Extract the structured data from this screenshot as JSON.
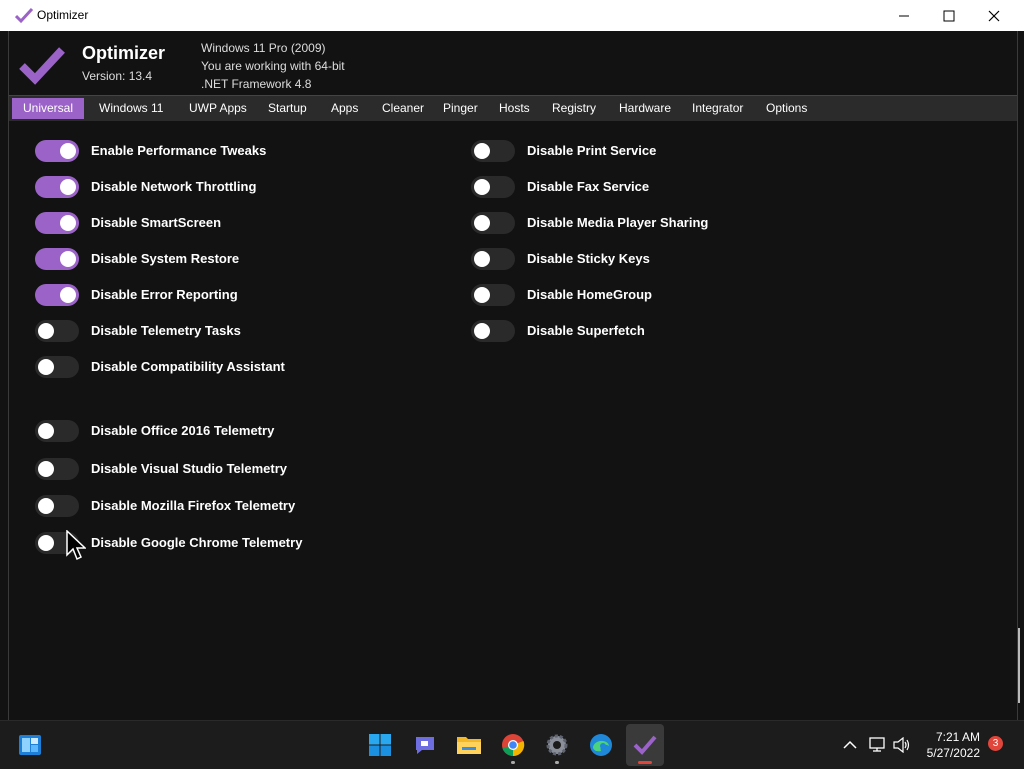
{
  "window": {
    "title": "Optimizer"
  },
  "app": {
    "name": "Optimizer",
    "version": "Version: 13.4",
    "sysinfo": [
      "Windows 11 Pro (2009)",
      "You are working with 64-bit",
      ".NET Framework 4.8"
    ],
    "accent": "#9b63c8"
  },
  "tabs": [
    {
      "label": "Universal",
      "active": true
    },
    {
      "label": "Windows 11",
      "active": false
    },
    {
      "label": "UWP Apps",
      "active": false
    },
    {
      "label": "Startup",
      "active": false
    },
    {
      "label": "Apps",
      "active": false
    },
    {
      "label": "Cleaner",
      "active": false
    },
    {
      "label": "Pinger",
      "active": false
    },
    {
      "label": "Hosts",
      "active": false
    },
    {
      "label": "Registry",
      "active": false
    },
    {
      "label": "Hardware",
      "active": false
    },
    {
      "label": "Integrator",
      "active": false
    },
    {
      "label": "Options",
      "active": false
    }
  ],
  "left_options": [
    {
      "label": "Enable Performance Tweaks",
      "on": true
    },
    {
      "label": "Disable Network Throttling",
      "on": true
    },
    {
      "label": "Disable SmartScreen",
      "on": true
    },
    {
      "label": "Disable System Restore",
      "on": true
    },
    {
      "label": "Disable Error Reporting",
      "on": true
    },
    {
      "label": "Disable Telemetry Tasks",
      "on": false
    },
    {
      "label": "Disable Compatibility Assistant",
      "on": false
    },
    {
      "label": "Disable Office 2016 Telemetry",
      "on": false
    },
    {
      "label": "Disable Visual Studio Telemetry",
      "on": false
    },
    {
      "label": "Disable Mozilla Firefox Telemetry",
      "on": false
    },
    {
      "label": "Disable Google Chrome Telemetry",
      "on": false
    }
  ],
  "right_options": [
    {
      "label": "Disable Print Service",
      "on": false
    },
    {
      "label": "Disable Fax Service",
      "on": false
    },
    {
      "label": "Disable Media Player Sharing",
      "on": false
    },
    {
      "label": "Disable Sticky Keys",
      "on": false
    },
    {
      "label": "Disable HomeGroup",
      "on": false
    },
    {
      "label": "Disable Superfetch",
      "on": false
    }
  ],
  "taskbar": {
    "icons": [
      "widgets-icon",
      "start-icon",
      "teams-chat-icon",
      "file-explorer-icon",
      "chrome-icon",
      "settings-icon",
      "edge-icon",
      "optimizer-icon"
    ],
    "time": "7:21 AM",
    "date": "5/27/2022",
    "notification_count": "3"
  }
}
